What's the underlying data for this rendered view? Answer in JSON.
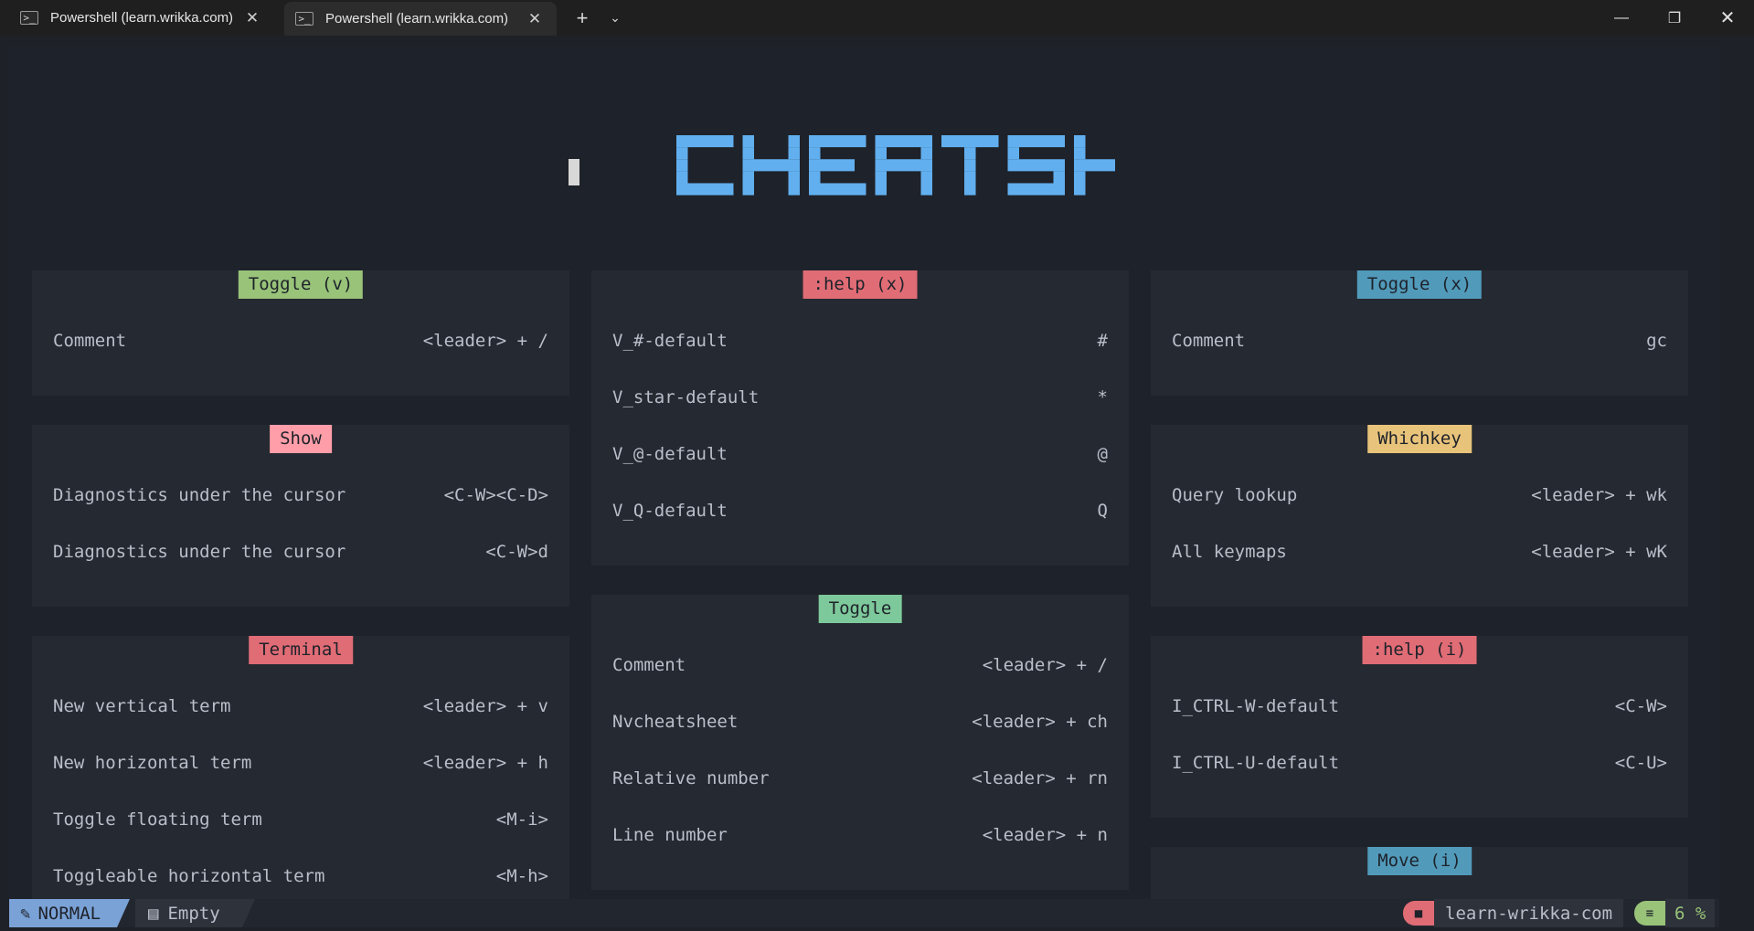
{
  "window": {
    "tabs": [
      {
        "title": "Powershell (learn.wrikka.com)",
        "active": false
      },
      {
        "title": "Powershell (learn.wrikka.com)",
        "active": true
      }
    ],
    "new_tab_label": "+",
    "dropdown_label": "⌄",
    "minimize_label": "—",
    "maximize_label": "❐",
    "close_label": "✕",
    "tab_close_label": "✕"
  },
  "banner": {
    "title": "CHEATSHEET",
    "color": "#61afef"
  },
  "columns": [
    [
      {
        "header": "Toggle (v)",
        "color": "#98c379",
        "rows": [
          {
            "desc": "Comment",
            "keys": "<leader> + /"
          }
        ]
      },
      {
        "header": "Show",
        "color": "#ff9ea8",
        "rows": [
          {
            "desc": "Diagnostics under the cursor",
            "keys": "<C-W><C-D>"
          },
          {
            "desc": "Diagnostics under the cursor",
            "keys": "<C-W>d"
          }
        ]
      },
      {
        "header": "Terminal",
        "color": "#e06c75",
        "rows": [
          {
            "desc": "New vertical term",
            "keys": "<leader> + v"
          },
          {
            "desc": "New horizontal term",
            "keys": "<leader> + h"
          },
          {
            "desc": "Toggle floating term",
            "keys": "<M-i>"
          },
          {
            "desc": "Toggleable horizontal term",
            "keys": "<M-h>"
          }
        ]
      }
    ],
    [
      {
        "header": ":help (x)",
        "color": "#e06c75",
        "rows": [
          {
            "desc": "V_#-default",
            "keys": "#"
          },
          {
            "desc": "V_star-default",
            "keys": "*"
          },
          {
            "desc": "V_@-default",
            "keys": "@"
          },
          {
            "desc": "V_Q-default",
            "keys": "Q"
          }
        ]
      },
      {
        "header": "Toggle",
        "color": "#7ec99b",
        "rows": [
          {
            "desc": "Comment",
            "keys": "<leader> + /"
          },
          {
            "desc": "Nvcheatsheet",
            "keys": "<leader> + ch"
          },
          {
            "desc": "Relative number",
            "keys": "<leader> + rn"
          },
          {
            "desc": "Line number",
            "keys": "<leader> + n"
          }
        ]
      }
    ],
    [
      {
        "header": "Toggle (x)",
        "color": "#519aba",
        "rows": [
          {
            "desc": "Comment",
            "keys": "gc"
          }
        ]
      },
      {
        "header": "Whichkey",
        "color": "#e8c37a",
        "rows": [
          {
            "desc": "Query lookup",
            "keys": "<leader> + wk"
          },
          {
            "desc": "All keymaps",
            "keys": "<leader> + wK"
          }
        ]
      },
      {
        "header": ":help (i)",
        "color": "#e06c75",
        "rows": [
          {
            "desc": "I_CTRL-W-default",
            "keys": "<C-W>"
          },
          {
            "desc": "I_CTRL-U-default",
            "keys": "<C-U>"
          }
        ]
      },
      {
        "header": "Move (i)",
        "color": "#519aba",
        "rows": []
      }
    ]
  ],
  "statusline": {
    "mode": "NORMAL",
    "file": "Empty",
    "cwd": "learn-wrikka-com",
    "progress": "6 %"
  }
}
